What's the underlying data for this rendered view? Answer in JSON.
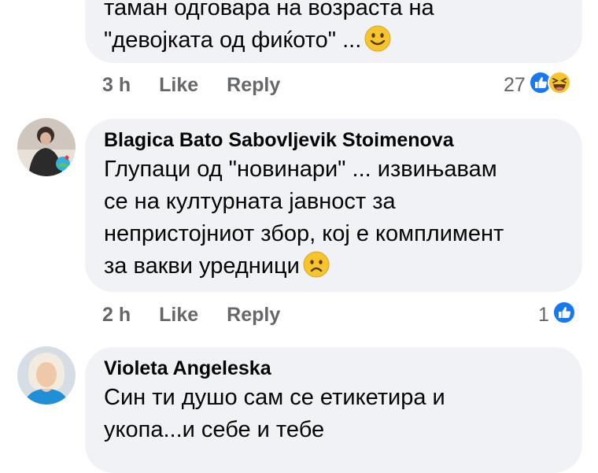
{
  "comments": [
    {
      "text_lines": [
        "таман одговара на возраста на",
        "\"девојката од фиќото\" ..."
      ],
      "time": "3 h",
      "like_label": "Like",
      "reply_label": "Reply",
      "reaction_count": "27",
      "reactions": [
        "like-icon",
        "haha-icon"
      ],
      "trailing_emoji": "smiling-face-icon"
    },
    {
      "author": "Blagica Bato Sabovljevik Stoimenova",
      "text_lines": [
        "Глупаци од \"новинари\" ... извињавам",
        "се на културната јавност за",
        "непристојниот збор, кој е комплимент",
        "за вакви уредници"
      ],
      "time": "2 h",
      "like_label": "Like",
      "reply_label": "Reply",
      "reaction_count": "1",
      "reactions": [
        "like-icon"
      ],
      "trailing_emoji": "frowning-face-icon"
    },
    {
      "author": "Violeta Angeleska",
      "text_lines": [
        "Син ти душо сам се етикетира и",
        "укопа...и себе и тебе"
      ]
    }
  ],
  "colors": {
    "bubble": "#f0f2f5",
    "meta_text": "#65676b",
    "like_blue": "#1877f2",
    "emoji_yellow": "#f7c42e"
  }
}
